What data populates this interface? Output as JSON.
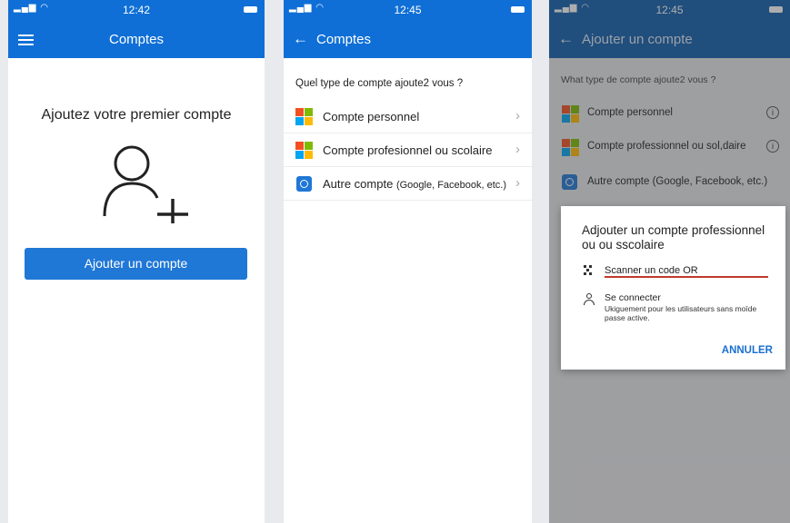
{
  "colors": {
    "primary": "#0f6fd6",
    "button": "#1f77d6",
    "cancel": "#1a6fd0",
    "underline": "#c0392b"
  },
  "screen1": {
    "status_time": "12:42",
    "title": "Comptes",
    "heading": "Ajoutez votre premier compte",
    "add_button": "Ajouter un compte"
  },
  "screen2": {
    "status_time": "12:45",
    "title": "Comptes",
    "question": "Quel type de compte ajoute2  vous ?",
    "options": [
      {
        "label": "Compte personnel",
        "icon": "microsoft-logo-icon"
      },
      {
        "label": "Compte profesionnel ou scolaire",
        "icon": "microsoft-logo-icon"
      },
      {
        "label": "Autre compte",
        "label_small": "(Google, Facebook, etc.)",
        "icon": "account-icon"
      }
    ]
  },
  "screen3": {
    "status_time": "12:45",
    "title": "Ajouter un compte",
    "question": "What type de compte ajoute2 vous ?",
    "options": [
      {
        "label": "Compte personnel"
      },
      {
        "label": "Compte professionnel ou sol,daire"
      },
      {
        "label": "Autre compte (Google, Facebook, etc.)"
      }
    ],
    "dialog": {
      "title": "Adjouter un compte professionnel ou ou sscolaire",
      "scan_label": "Scanner un code OR",
      "connect_label": "Se connecter",
      "connect_sub": "Ukiguement pour les utilisateurs sans moīde passe active.",
      "cancel": "ANNULER"
    }
  }
}
